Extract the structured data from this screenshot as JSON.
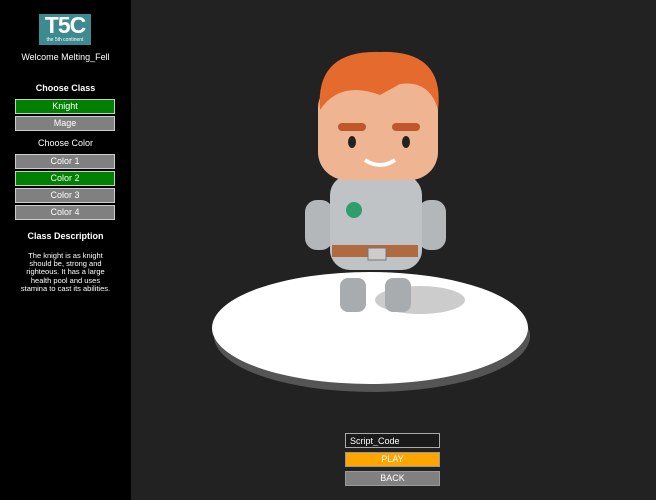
{
  "logo": {
    "title": "T5C",
    "subtitle": "the 5th continent"
  },
  "welcome": "Welcome Melting_Fell",
  "class_section": {
    "heading": "Choose Class",
    "options": [
      {
        "label": "Knight",
        "selected": true
      },
      {
        "label": "Mage",
        "selected": false
      }
    ]
  },
  "color_section": {
    "heading": "Choose Color",
    "options": [
      {
        "label": "Color 1",
        "selected": false
      },
      {
        "label": "Color 2",
        "selected": true
      },
      {
        "label": "Color 3",
        "selected": false
      },
      {
        "label": "Color 4",
        "selected": false
      }
    ]
  },
  "description": {
    "heading": "Class Description",
    "text": "The knight is as knight should be, strong and righteous. It has a large health pool and uses stamina to cast its abilities."
  },
  "bottom": {
    "code_value": "Script_Code",
    "play": "PLAY",
    "back": "BACK"
  },
  "colors": {
    "selected": "#008000",
    "unselected": "#808080",
    "play": "#ffa500"
  }
}
